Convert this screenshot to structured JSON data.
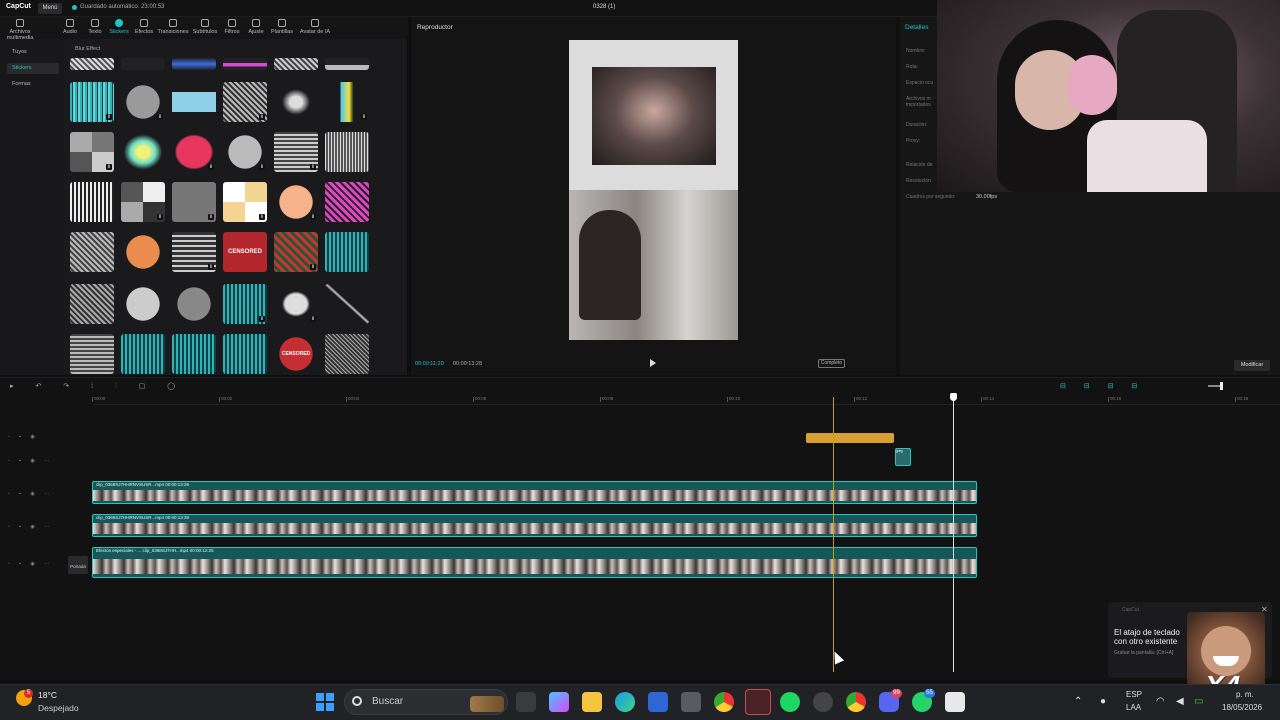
{
  "app": {
    "logo": "CapCut",
    "menu_label": "Menú",
    "autosave_text": "Guardado automático: 23:00:53",
    "project_title": "0328 (1)"
  },
  "toolbar": {
    "items": [
      {
        "label": "Archivos multimedia",
        "icon": "media-icon"
      },
      {
        "label": "Audio",
        "icon": "audio-icon"
      },
      {
        "label": "Texto",
        "icon": "text-icon"
      },
      {
        "label": "Stickers",
        "icon": "stickers-icon",
        "active": true
      },
      {
        "label": "Efectos",
        "icon": "effects-icon"
      },
      {
        "label": "Transiciones",
        "icon": "transitions-icon"
      },
      {
        "label": "Subtítulos",
        "icon": "subtitles-icon"
      },
      {
        "label": "Filtros",
        "icon": "filters-icon"
      },
      {
        "label": "Ajuste",
        "icon": "adjust-icon"
      },
      {
        "label": "Plantillas",
        "icon": "templates-icon"
      },
      {
        "label": "Avatar de IA",
        "icon": "ai-avatar-icon"
      }
    ]
  },
  "left_nav": {
    "items": [
      {
        "label": "Tuyos"
      },
      {
        "label": "Stickers",
        "active": true
      },
      {
        "label": "Formas"
      }
    ]
  },
  "stickers_panel": {
    "breadcrumb": "Blur Effect",
    "censored_label": "CENSORED",
    "dl_glyph": "⬇"
  },
  "player": {
    "title": "Reproductor",
    "current_time": "00:00:11:20",
    "total_time": "00:00:13:28",
    "ratio_label": "Completo"
  },
  "details": {
    "tab": "Detalles",
    "fields": [
      "Nombre:",
      "Ruta:",
      "Espacio ocu",
      "Archivos m importados",
      "Duración:",
      "Proxy:",
      "Relación de",
      "Resolución",
      "Cuadros por segundo:"
    ],
    "fps_value": "30.00fps",
    "modify_label": "Modificar"
  },
  "timeline": {
    "ruler_labels": [
      "00:00",
      "00:02",
      "00:04",
      "00:06",
      "00:08",
      "00:10",
      "00:12",
      "00:14",
      "00:16",
      "00:18"
    ],
    "clips": [
      {
        "label": "clip_0368SJ7HHRNVSUSR...mp4  00:00:13:28"
      },
      {
        "label": "clip_0368SJ7HHRNVSUSR...mp4  00:00:13:28"
      },
      {
        "label": "Efectos especiales - ... clip_0368SJ7HH...mp4  00:00:12:25"
      }
    ],
    "small_clip_label": "jpeg",
    "portada_label": "Portada"
  },
  "toast": {
    "app": "CapCut",
    "title": "El atajo de teclado con otro existente",
    "subtitle": "Grabar la pantalla: [Ctrl+A]",
    "meme_text": "X4"
  },
  "taskbar": {
    "temperature": "18°C",
    "weather": "Despejado",
    "weather_badge": "5",
    "search_placeholder": "Buscar",
    "lang_line1": "ESP",
    "lang_line2": "LAA",
    "time": "p. m.",
    "date": "18/05/2026",
    "badge_discord": "99",
    "badge_whatsapp": "55"
  }
}
